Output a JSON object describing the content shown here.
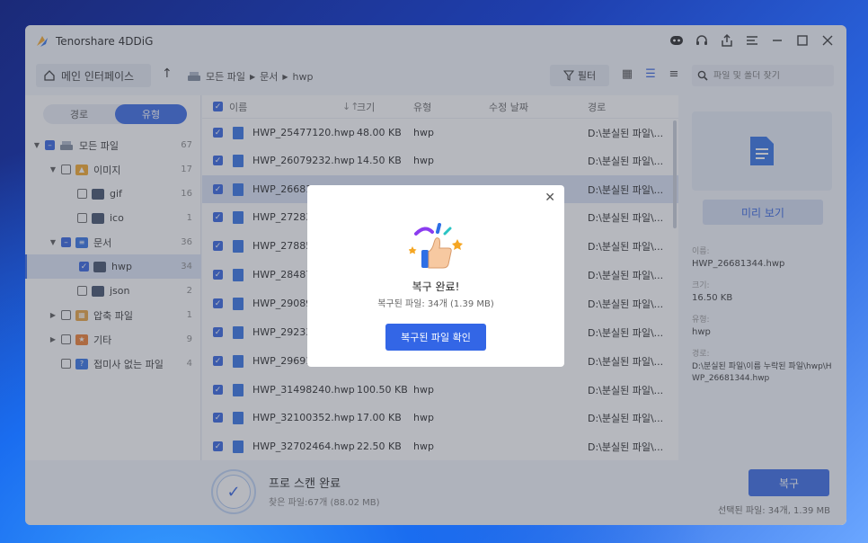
{
  "app": {
    "title": "Tenorshare 4DDiG"
  },
  "toolbar": {
    "home_label": "메인 인터페이스",
    "breadcrumb": [
      "모든 파일",
      "문서",
      "hwp"
    ],
    "filter_label": "필터",
    "search_placeholder": "파일 및 폴더 찾기"
  },
  "sidebar": {
    "tabs": [
      "경로",
      "유형"
    ],
    "active_tab": "유형",
    "tree": [
      {
        "label": "모든 파일",
        "count": "67"
      },
      {
        "label": "이미지",
        "count": "17"
      },
      {
        "label": "gif",
        "count": "16"
      },
      {
        "label": "ico",
        "count": "1"
      },
      {
        "label": "문서",
        "count": "36"
      },
      {
        "label": "hwp",
        "count": "34"
      },
      {
        "label": "json",
        "count": "2"
      },
      {
        "label": "압축 파일",
        "count": "1"
      },
      {
        "label": "기타",
        "count": "9"
      },
      {
        "label": "접미사 없는 파일",
        "count": "4"
      }
    ]
  },
  "table": {
    "headers": {
      "name": "이름",
      "size": "크기",
      "type": "유형",
      "date": "수정 날짜",
      "path": "경로"
    },
    "rows": [
      {
        "name": "HWP_25477120.hwp",
        "size": "48.00 KB",
        "type": "hwp",
        "path": "D:\\분실된 파일\\..."
      },
      {
        "name": "HWP_26079232.hwp",
        "size": "14.50 KB",
        "type": "hwp",
        "path": "D:\\분실된 파일\\..."
      },
      {
        "name": "HWP_26681",
        "size": "",
        "type": "",
        "path": "D:\\분실된 파일\\..."
      },
      {
        "name": "HWP_27283",
        "size": "",
        "type": "",
        "path": "D:\\분실된 파일\\..."
      },
      {
        "name": "HWP_27885",
        "size": "",
        "type": "",
        "path": "D:\\분실된 파일\\..."
      },
      {
        "name": "HWP_28487",
        "size": "",
        "type": "",
        "path": "D:\\분실된 파일\\..."
      },
      {
        "name": "HWP_29089",
        "size": "",
        "type": "",
        "path": "D:\\분실된 파일\\..."
      },
      {
        "name": "HWP_29233",
        "size": "",
        "type": "",
        "path": "D:\\분실된 파일\\..."
      },
      {
        "name": "HWP_29691",
        "size": "",
        "type": "",
        "path": "D:\\분실된 파일\\..."
      },
      {
        "name": "HWP_31498240.hwp",
        "size": "100.50 KB",
        "type": "hwp",
        "path": "D:\\분실된 파일\\..."
      },
      {
        "name": "HWP_32100352.hwp",
        "size": "17.00 KB",
        "type": "hwp",
        "path": "D:\\분실된 파일\\..."
      },
      {
        "name": "HWP_32702464.hwp",
        "size": "22.50 KB",
        "type": "hwp",
        "path": "D:\\분실된 파일\\..."
      }
    ]
  },
  "detail": {
    "preview_button": "미리 보기",
    "name_label": "이름:",
    "name_value": "HWP_26681344.hwp",
    "size_label": "크기:",
    "size_value": "16.50 KB",
    "type_label": "유형:",
    "type_value": "hwp",
    "path_label": "경로:",
    "path_value": "D:\\분실된 파일\\이름 누락된 파일\\hwp\\HWP_26681344.hwp"
  },
  "bottom": {
    "scan_title": "프로 스캔 완료",
    "scan_sub": "찾은 파일:67개 (88.02 MB)",
    "recover_label": "복구",
    "selected_info": "선택된 파일: 34개, 1.39 MB"
  },
  "modal": {
    "title": "복구 완료!",
    "subtitle": "복구된 파일: 34개 (1.39 MB)",
    "button": "복구된 파일 확인"
  },
  "colors": {
    "accent": "#3366e6",
    "selected_row": "#d9e2f5"
  }
}
